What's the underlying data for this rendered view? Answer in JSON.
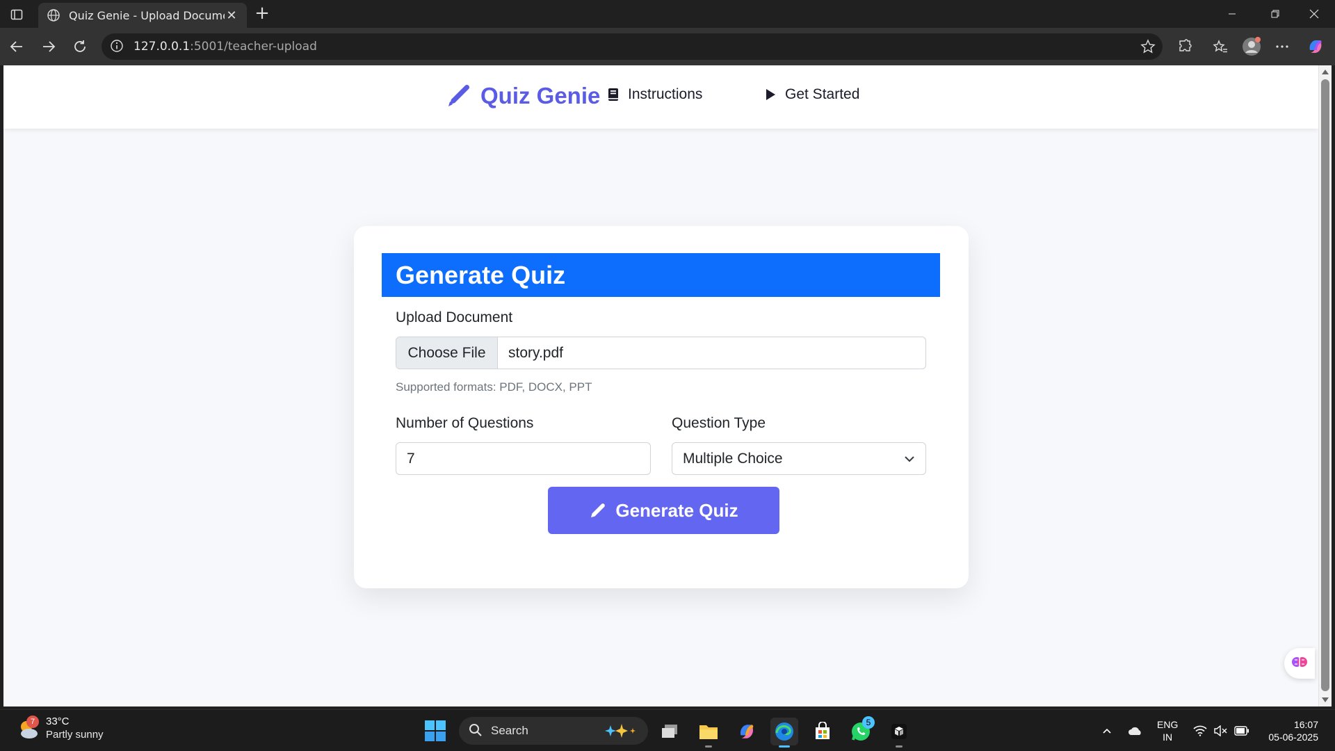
{
  "browser": {
    "tab_title": "Quiz Genie - Upload Document",
    "url_host": "127.0.0.1",
    "url_path": ":5001/teacher-upload"
  },
  "navbar": {
    "brand": "Quiz Genie",
    "links": [
      {
        "label": "Instructions",
        "icon": "book-icon"
      },
      {
        "label": "Get Started",
        "icon": "play-icon"
      }
    ]
  },
  "form": {
    "title": "Generate Quiz",
    "upload_label": "Upload Document",
    "choose_file_label": "Choose File",
    "file_name": "story.pdf",
    "help_text": "Supported formats: PDF, DOCX, PPT",
    "num_questions_label": "Number of Questions",
    "num_questions_value": "7",
    "question_type_label": "Question Type",
    "question_type_value": "Multiple Choice",
    "submit_label": "Generate Quiz"
  },
  "colors": {
    "brand": "#5a5ce6",
    "header_blue": "#0d6efd",
    "button_purple": "#6366f1"
  },
  "taskbar": {
    "weather_temp": "33°C",
    "weather_condition": "Partly sunny",
    "weather_badge": "7",
    "search_placeholder": "Search",
    "whatsapp_badge": "5",
    "lang_top": "ENG",
    "lang_bottom": "IN",
    "time": "16:07",
    "date": "05-06-2025"
  }
}
